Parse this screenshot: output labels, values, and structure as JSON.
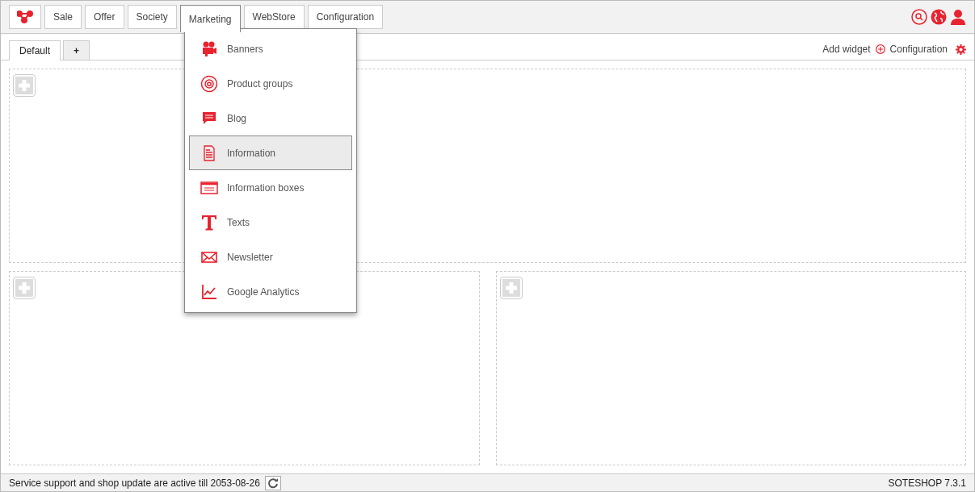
{
  "nav": [
    {
      "label": "Sale",
      "selected": false
    },
    {
      "label": "Offer",
      "selected": false
    },
    {
      "label": "Society",
      "selected": false
    },
    {
      "label": "Marketing",
      "selected": true
    },
    {
      "label": "WebStore",
      "selected": false
    },
    {
      "label": "Configuration",
      "selected": false
    }
  ],
  "menu": [
    {
      "label": "Banners",
      "selected": false
    },
    {
      "label": "Product groups",
      "selected": false
    },
    {
      "label": "Blog",
      "selected": false
    },
    {
      "label": "Information",
      "selected": true
    },
    {
      "label": "Information boxes",
      "selected": false
    },
    {
      "label": "Texts",
      "selected": false
    },
    {
      "label": "Newsletter",
      "selected": false
    },
    {
      "label": "Google Analytics",
      "selected": false
    }
  ],
  "tabs": [
    {
      "label": "Default",
      "selected": true
    },
    {
      "label": "+",
      "selected": false
    }
  ],
  "toolbar": {
    "add_widget": "Add widget",
    "configuration": "Configuration"
  },
  "status_bar": {
    "message": "Service support and shop update are active till 2053-08-26",
    "version": "SOTESHOP 7.3.1"
  }
}
